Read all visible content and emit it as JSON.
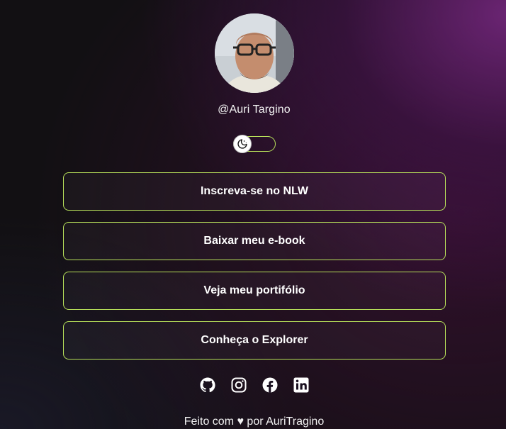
{
  "profile": {
    "handle": "@Auri Targino",
    "avatar_icon": "user-photo"
  },
  "theme_switch": {
    "icon": "moon-icon",
    "accent_color": "#b7e05a"
  },
  "links": [
    {
      "label": "Inscreva-se no NLW"
    },
    {
      "label": "Baixar meu e-book"
    },
    {
      "label": "Veja meu portifólio"
    },
    {
      "label": "Conheça o Explorer"
    }
  ],
  "social": [
    {
      "icon": "github-icon"
    },
    {
      "icon": "instagram-icon"
    },
    {
      "icon": "facebook-icon"
    },
    {
      "icon": "linkedin-icon"
    }
  ],
  "footer": {
    "text": "Feito com ♥ por AuriTragino"
  }
}
